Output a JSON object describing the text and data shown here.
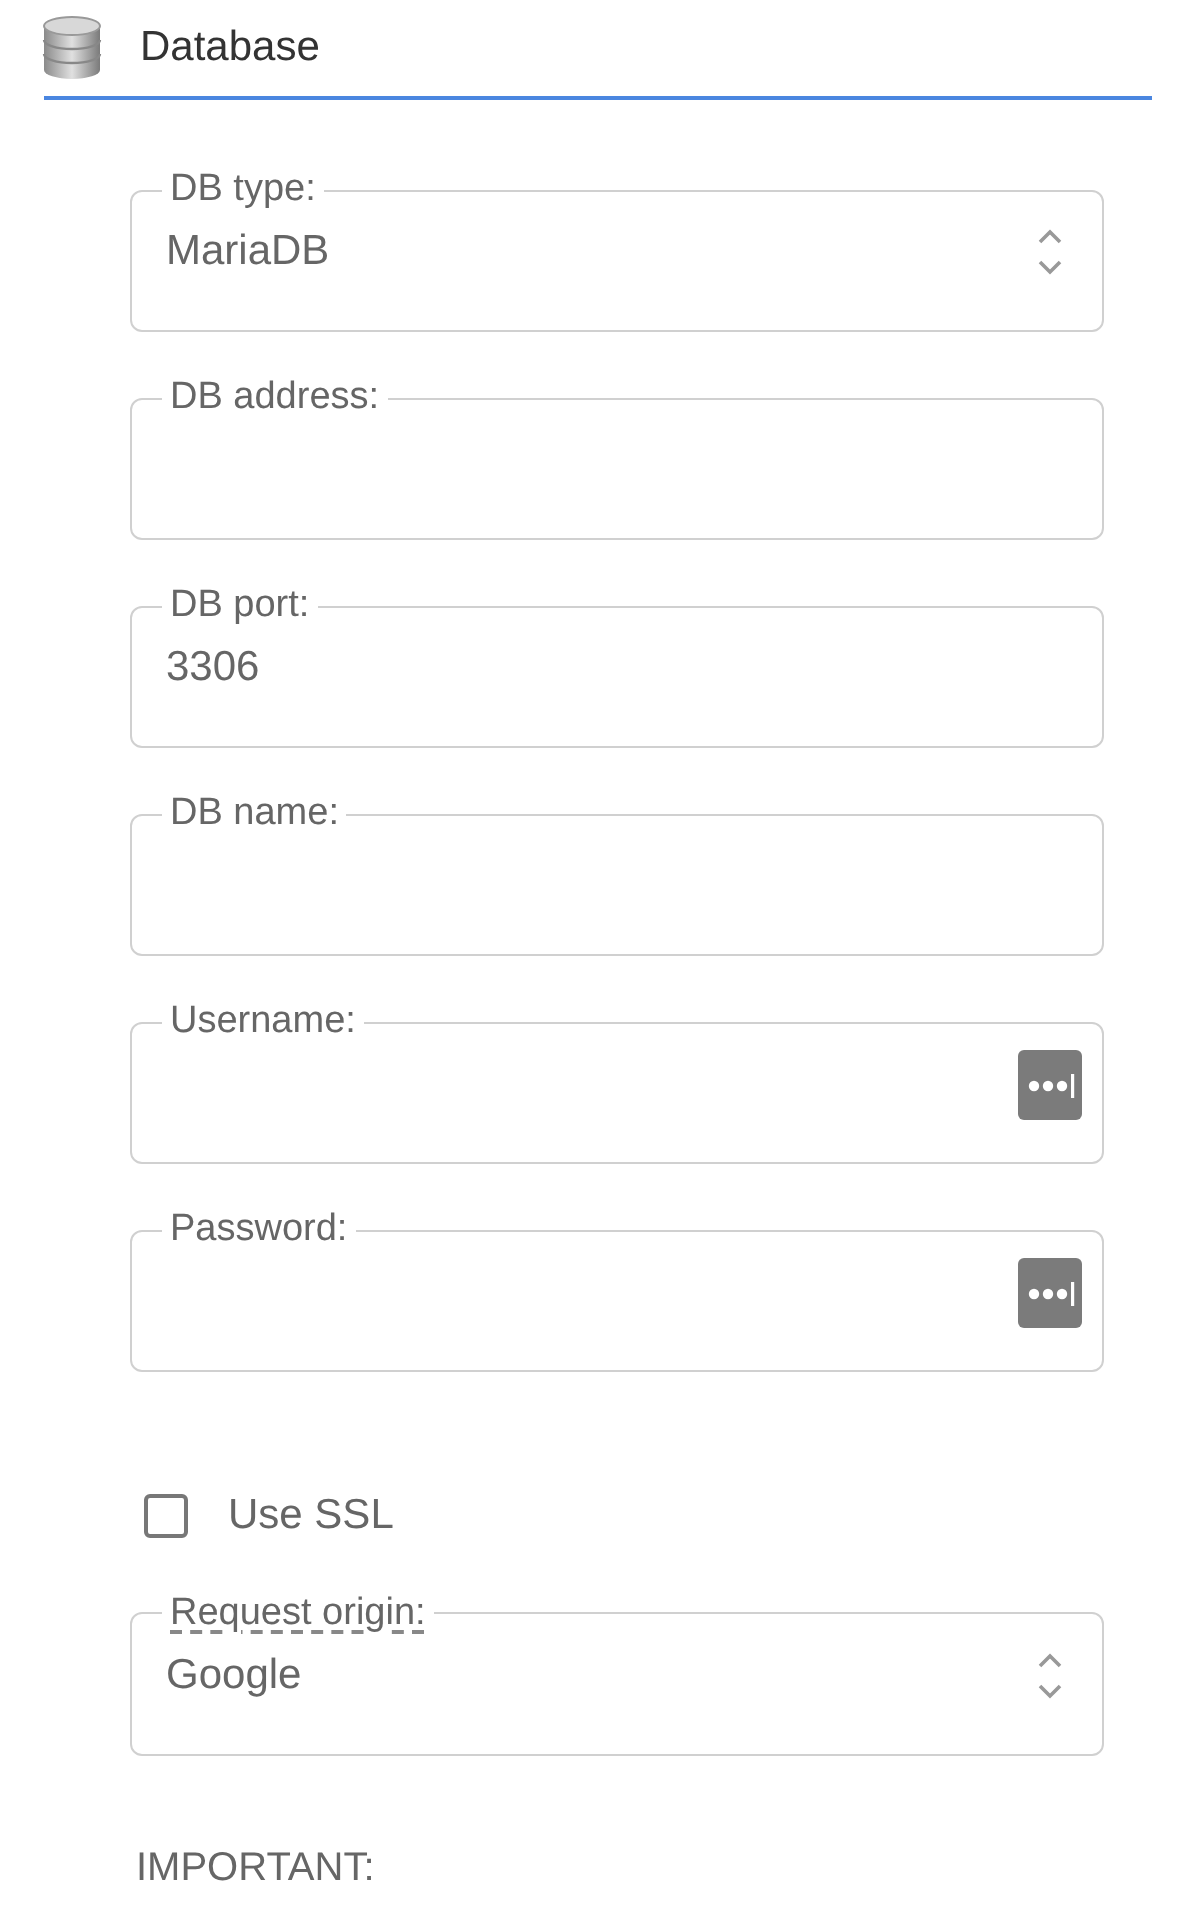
{
  "section": {
    "title": "Database"
  },
  "fields": [
    {
      "kind": "select",
      "label": "DB type:",
      "value": "MariaDB",
      "tooltip": false
    },
    {
      "kind": "text",
      "label": "DB address:",
      "tooltip": false
    },
    {
      "kind": "text",
      "label": "DB port:",
      "value": "3306",
      "tooltip": false
    },
    {
      "kind": "text",
      "label": "DB name:",
      "tooltip": false
    },
    {
      "kind": "password",
      "label": "Username:",
      "tooltip": false
    },
    {
      "kind": "password",
      "label": "Password:",
      "tooltip": false
    },
    {
      "kind": "checkbox",
      "label": "Use SSL",
      "checked": false
    },
    {
      "kind": "select",
      "label": "Request origin:",
      "value": "Google",
      "tooltip": true
    }
  ],
  "note": "IMPORTANT:"
}
